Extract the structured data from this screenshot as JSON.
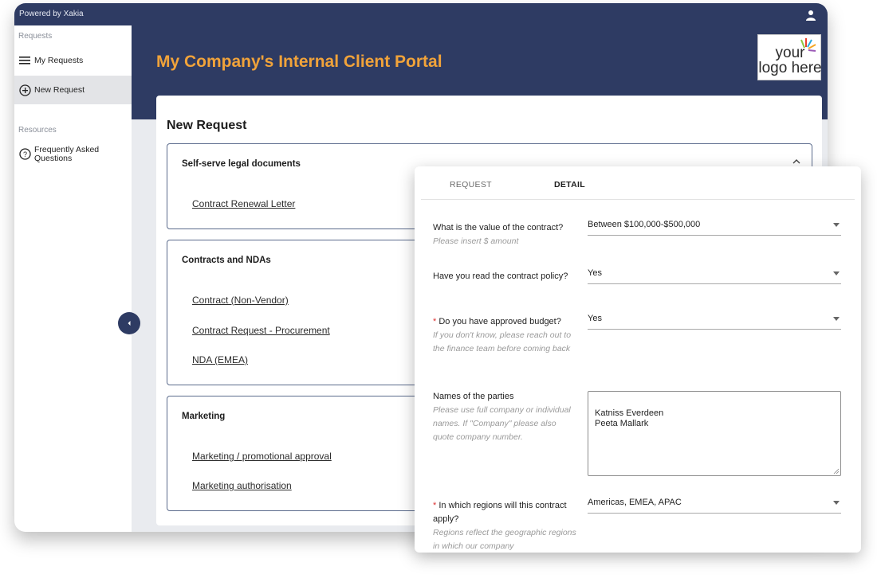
{
  "topbar": {
    "powered_by": "Powered by Xakia",
    "user_icon": "user-icon"
  },
  "sidebar": {
    "requests_heading": "Requests",
    "items": [
      {
        "label": "My Requests",
        "icon": "list-icon"
      },
      {
        "label": "New Request",
        "icon": "plus-circle-icon",
        "active": true
      }
    ],
    "resources_heading": "Resources",
    "faq": {
      "label_line1": "Frequently Asked",
      "label_line2": "Questions",
      "icon": "question-circle-icon"
    }
  },
  "header": {
    "title": "My Company's Internal Client Portal",
    "logo": {
      "line1": "your",
      "line2": "logo here"
    }
  },
  "main": {
    "title": "New Request",
    "groups": [
      {
        "title": "Self-serve legal documents",
        "links": [
          "Contract Renewal Letter"
        ],
        "expanded": true
      },
      {
        "title": "Contracts and NDAs",
        "links": [
          "Contract (Non-Vendor)",
          "Contract Request - Procurement",
          "NDA (EMEA)"
        ]
      },
      {
        "title": "Marketing",
        "links": [
          "Marketing / promotional approval",
          "Marketing authorisation"
        ]
      }
    ]
  },
  "panel": {
    "tabs": [
      {
        "label": "REQUEST"
      },
      {
        "label": "DETAIL",
        "active": true
      }
    ],
    "questions": [
      {
        "label": "What is the value of the contract?",
        "help": "Please insert $ amount",
        "value": "Between $100,000-$500,000",
        "required": false
      },
      {
        "label": "Have you read the contract policy?",
        "help": "",
        "value": "Yes",
        "required": false
      },
      {
        "label": "Do you have approved budget?",
        "help": "If you don't know, please reach out to the finance team before coming back",
        "value": "Yes",
        "required": true
      },
      {
        "label": "Names of the parties",
        "help": "Please use full company or individual names. If \"Company\" please also quote company number.",
        "value": "Katniss Everdeen\nPeeta Mallark",
        "required": false
      },
      {
        "label": "In which regions will this contract apply?",
        "help": "Regions reflect the geographic regions in which our company",
        "value": "Americas, EMEA, APAC",
        "required": true
      }
    ]
  },
  "colors": {
    "navy": "#2e3b63",
    "accent_orange": "#f1a33a",
    "required_red": "#d33333"
  }
}
